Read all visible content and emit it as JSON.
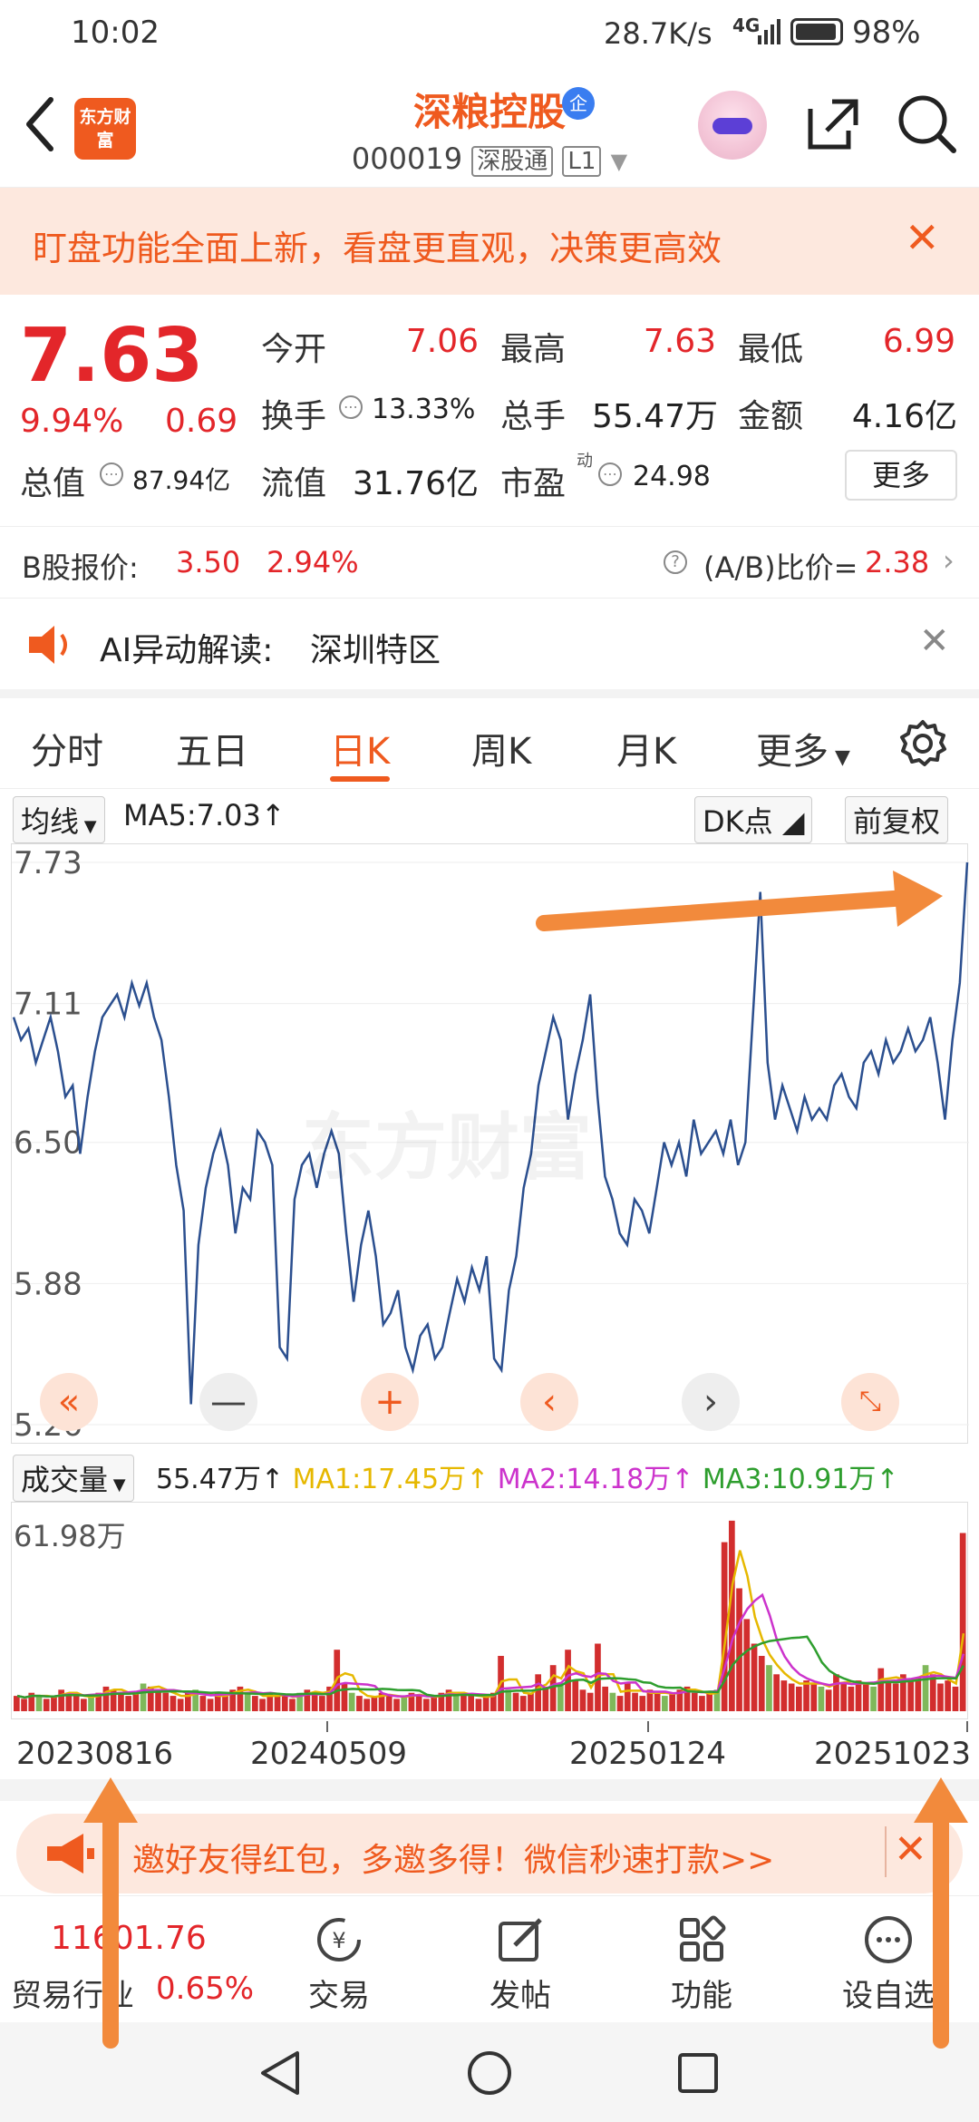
{
  "status_bar": {
    "time": "10:02",
    "net_speed": "28.7K/s",
    "signal": "4G",
    "battery": "98%"
  },
  "header": {
    "logo_text": "东方财富",
    "stock_name": "深粮控股",
    "verified_badge": "企",
    "code": "000019",
    "market_tag": "深股通",
    "level_tag": "L1"
  },
  "banner": {
    "text": "盯盘功能全面上新，看盘更直观，决策更高效"
  },
  "quote": {
    "price": "7.63",
    "change_pct": "9.94%",
    "change_amt": "0.69",
    "open_label": "今开",
    "open_value": "7.06",
    "high_label": "最高",
    "high_value": "7.63",
    "low_label": "最低",
    "low_value": "6.99",
    "turnover_label": "换手",
    "turnover_value": "13.33%",
    "volume_label": "总手",
    "volume_value": "55.47万",
    "amount_label": "金额",
    "amount_value": "4.16亿",
    "mktcap_label": "总值",
    "mktcap_value": "87.94亿",
    "float_label": "流值",
    "float_value": "31.76亿",
    "pe_label": "市盈",
    "pe_sup": "动",
    "pe_value": "24.98",
    "more_button": "更多"
  },
  "b_share": {
    "label": "B股报价:",
    "price": "3.50",
    "pct": "2.94%",
    "ratio_label": "(A/B)比价=",
    "ratio_value": "2.38"
  },
  "ai_bar": {
    "label": "AI异动解读:",
    "value": "深圳特区"
  },
  "tabs": [
    "分时",
    "五日",
    "日K",
    "周K",
    "月K",
    "更多"
  ],
  "active_tab": "日K",
  "chart_toolbar": {
    "ma_select": "均线",
    "ma5": "MA5:7.03",
    "dk_button": "DK点",
    "adjust_button": "前复权"
  },
  "chart_data": [
    {
      "type": "line",
      "title": "",
      "yticks": [
        "7.73",
        "7.11",
        "6.50",
        "5.88",
        "5.26"
      ],
      "ylim": [
        5.26,
        7.73
      ],
      "grid": true,
      "series": [
        {
          "name": "",
          "color": "#2b4f8f",
          "values": [
            7.05,
            6.95,
            7.0,
            6.85,
            6.95,
            7.05,
            6.9,
            6.7,
            6.75,
            6.45,
            6.7,
            6.9,
            7.05,
            7.1,
            7.15,
            7.05,
            7.2,
            7.1,
            7.2,
            7.05,
            6.95,
            6.7,
            6.4,
            6.2,
            5.35,
            6.05,
            6.3,
            6.45,
            6.55,
            6.4,
            6.1,
            6.3,
            6.25,
            6.55,
            6.5,
            6.4,
            5.6,
            5.55,
            6.25,
            6.4,
            6.45,
            6.3,
            6.45,
            6.55,
            6.45,
            6.1,
            5.8,
            6.05,
            6.2,
            6.0,
            5.7,
            5.75,
            5.85,
            5.6,
            5.5,
            5.65,
            5.7,
            5.55,
            5.6,
            5.75,
            5.9,
            5.8,
            5.95,
            5.85,
            6.0,
            5.55,
            5.5,
            5.85,
            6.0,
            6.3,
            6.45,
            6.75,
            6.9,
            7.05,
            6.95,
            6.6,
            6.8,
            6.95,
            7.15,
            6.7,
            6.35,
            6.25,
            6.1,
            6.05,
            6.25,
            6.2,
            6.1,
            6.3,
            6.5,
            6.4,
            6.5,
            6.35,
            6.6,
            6.45,
            6.5,
            6.55,
            6.45,
            6.6,
            6.4,
            6.5,
            7.05,
            7.6,
            6.85,
            6.6,
            6.75,
            6.65,
            6.55,
            6.7,
            6.6,
            6.65,
            6.6,
            6.75,
            6.8,
            6.7,
            6.65,
            6.85,
            6.9,
            6.8,
            6.95,
            6.85,
            6.9,
            7.0,
            6.9,
            6.95,
            7.05,
            6.85,
            6.6,
            6.95,
            7.2,
            7.73
          ]
        }
      ]
    },
    {
      "type": "bar",
      "title": "",
      "label": "成交量",
      "value_label": "55.47万",
      "ma_labels": [
        {
          "name": "MA1:17.45万",
          "color": "#e6b800"
        },
        {
          "name": "MA2:14.18万",
          "color": "#cc33cc"
        },
        {
          "name": "MA3:10.91万",
          "color": "#2e9e2e"
        }
      ],
      "ymax_label": "61.98万",
      "ylim": [
        0,
        61.98
      ],
      "bar_color": "#d22e2e",
      "values": [
        5,
        4,
        6,
        5,
        4,
        5,
        7,
        6,
        5,
        4,
        5,
        6,
        8,
        7,
        6,
        5,
        6,
        9,
        8,
        7,
        6,
        5,
        4,
        6,
        7,
        5,
        4,
        6,
        5,
        7,
        8,
        6,
        5,
        4,
        6,
        5,
        5,
        4,
        6,
        7,
        6,
        5,
        8,
        20,
        9,
        6,
        5,
        4,
        5,
        6,
        5,
        4,
        5,
        6,
        5,
        4,
        5,
        6,
        7,
        5,
        6,
        5,
        4,
        5,
        6,
        18,
        7,
        6,
        5,
        6,
        12,
        8,
        15,
        9,
        20,
        10,
        7,
        6,
        22,
        8,
        6,
        5,
        9,
        6,
        5,
        7,
        6,
        5,
        6,
        7,
        8,
        6,
        5,
        6,
        7,
        55,
        62,
        40,
        30,
        22,
        18,
        15,
        12,
        10,
        9,
        8,
        10,
        9,
        8,
        7,
        12,
        9,
        8,
        10,
        9,
        8,
        14,
        10,
        9,
        12,
        10,
        11,
        15,
        12,
        9,
        10,
        8,
        58
      ]
    }
  ],
  "x_labels": [
    "20230816",
    "20240509",
    "20250124",
    "20251023"
  ],
  "watermark": "东方财富",
  "promo": {
    "text": "邀好友得红包，多邀多得！微信秒速打款>>"
  },
  "bottom_bar": {
    "index_value": "11601.76",
    "index_name": "贸易行业",
    "index_pct": "0.65%",
    "items": [
      "交易",
      "发帖",
      "功能",
      "设自选"
    ]
  },
  "colors": {
    "accent": "#ef5a1f",
    "up": "#e3262a",
    "line": "#2b4f8f"
  }
}
